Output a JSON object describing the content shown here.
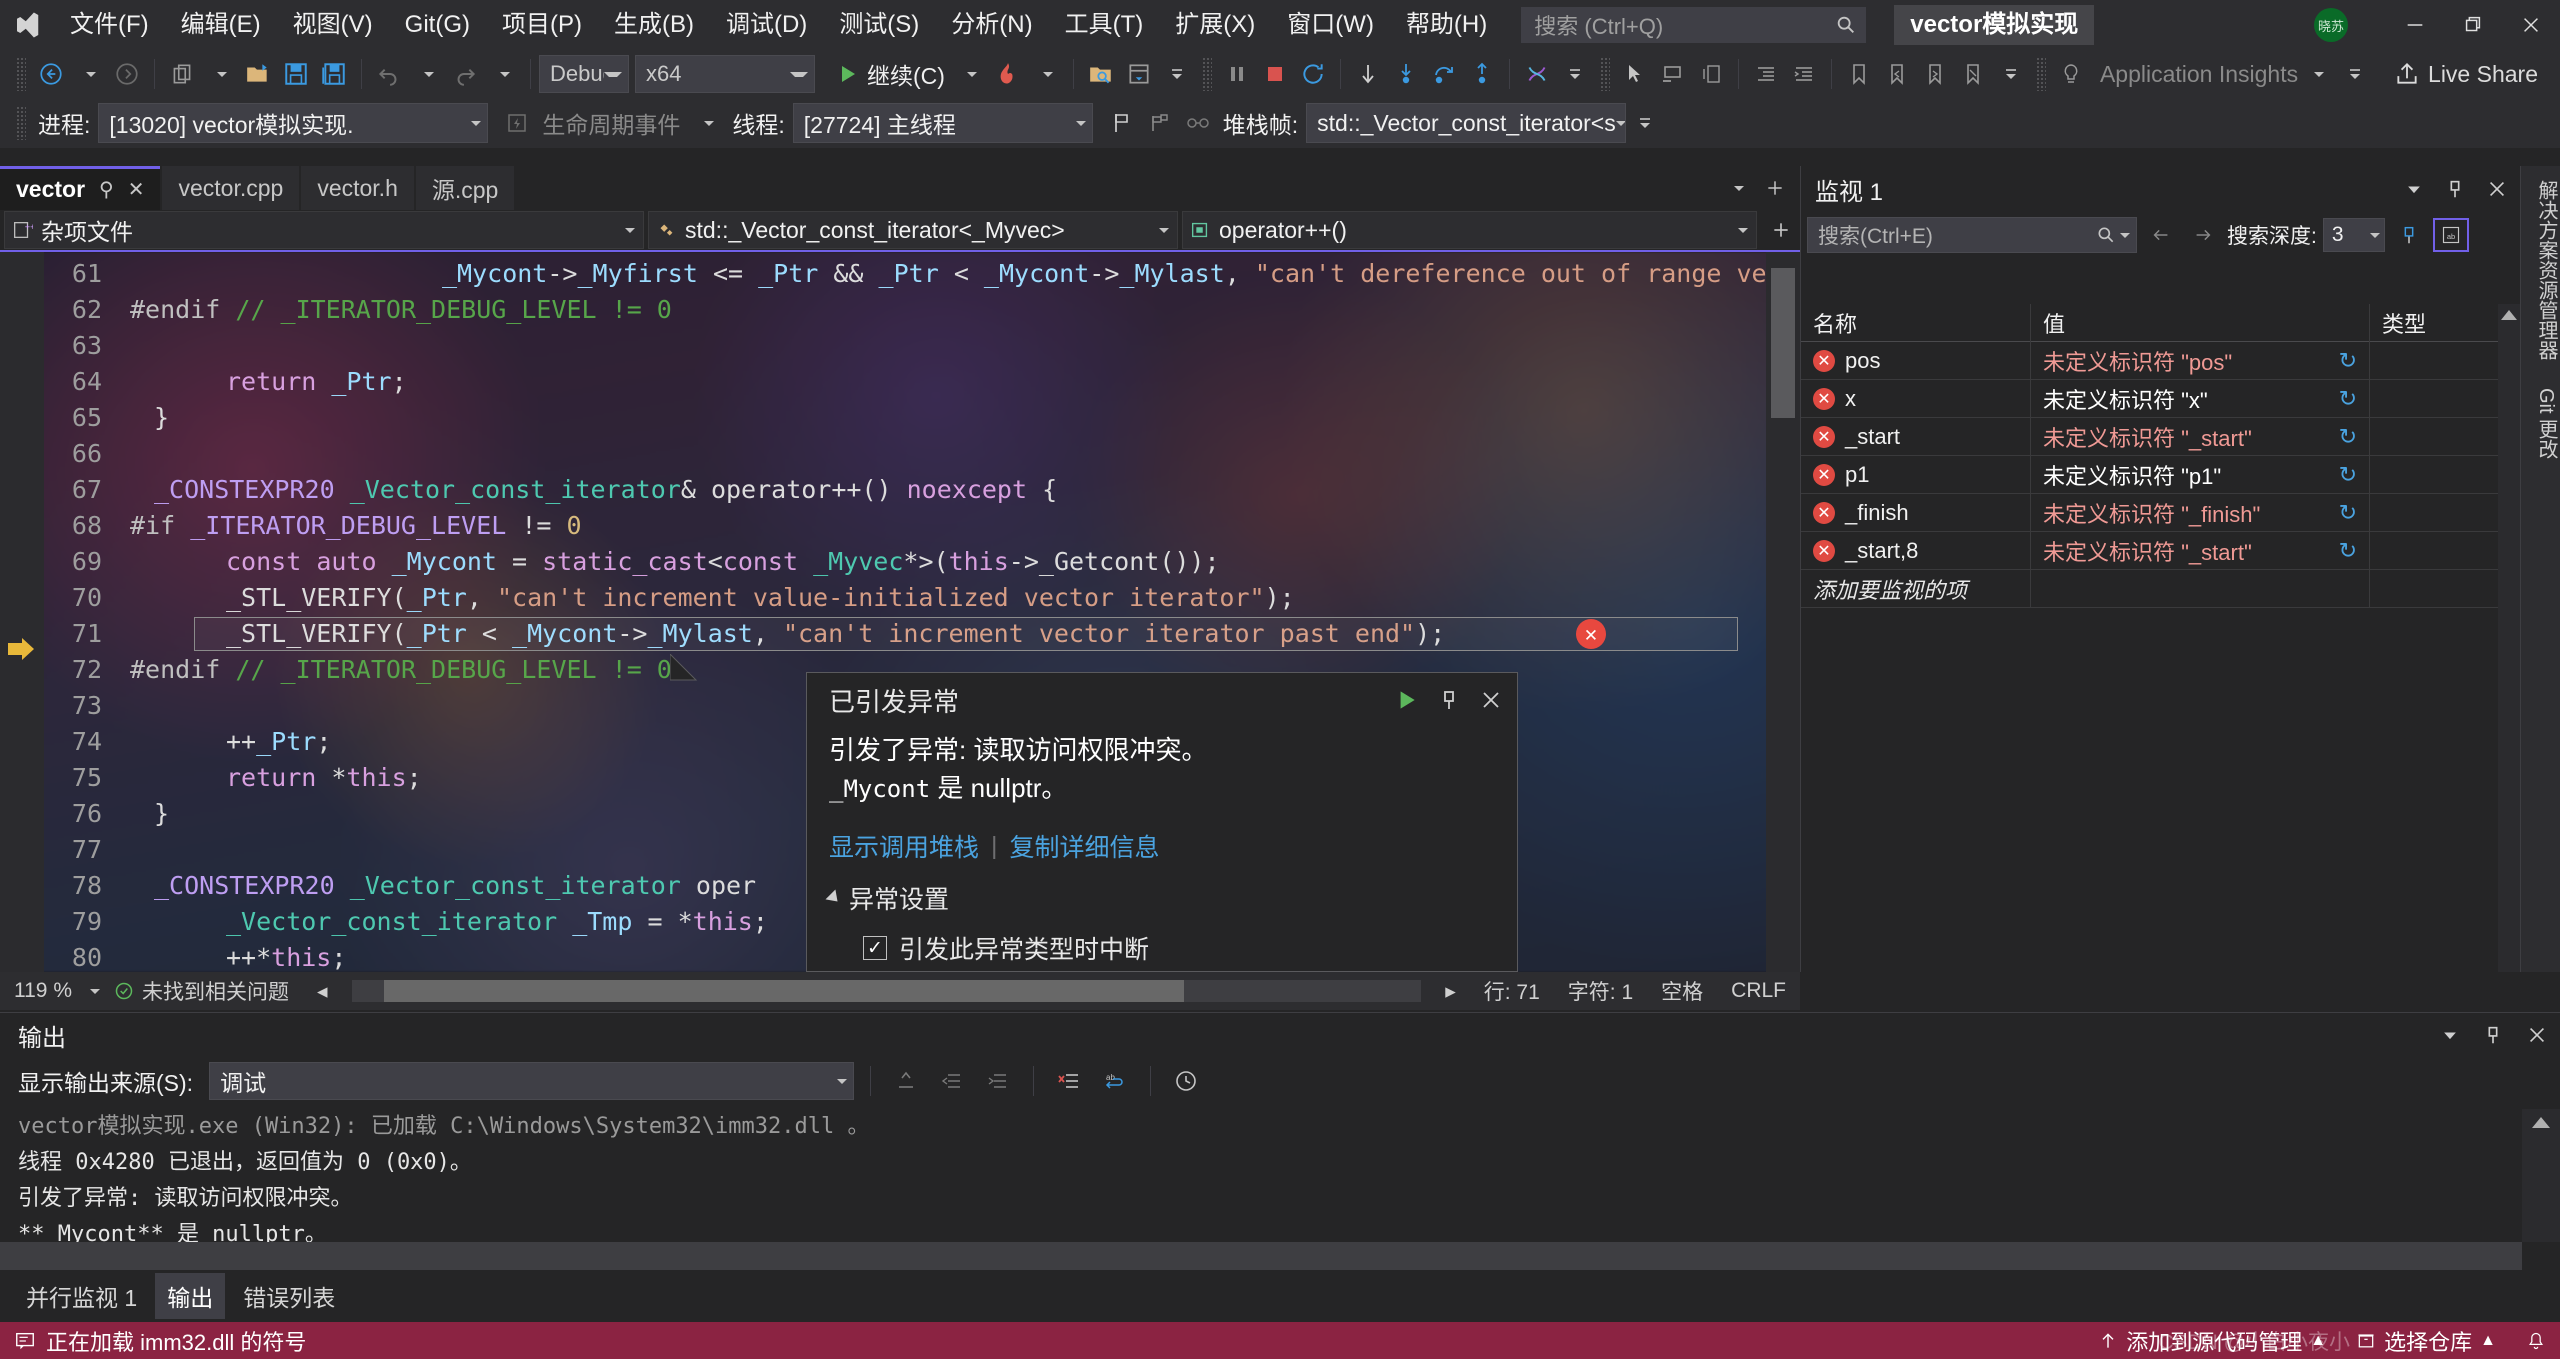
{
  "titlebar": {
    "logo": "visual-studio-logo",
    "menus": [
      "文件(F)",
      "编辑(E)",
      "视图(V)",
      "Git(G)",
      "项目(P)",
      "生成(B)",
      "调试(D)",
      "测试(S)",
      "分析(N)",
      "工具(T)",
      "扩展(X)",
      "窗口(W)",
      "帮助(H)"
    ],
    "search_placeholder": "搜索 (Ctrl+Q)",
    "project_name": "vector模拟实现",
    "avatar_initials": "晓苏",
    "minimize": "—",
    "restore": "❐",
    "close": "✕"
  },
  "toolbar": {
    "config": "Debug",
    "platform": "x64",
    "continue_label": "继续(C)",
    "app_insights": "Application Insights",
    "live_share": "Live Share"
  },
  "debugbar": {
    "process_label": "进程:",
    "process_value": "[13020] vector模拟实现.",
    "lifecycle_label": "生命周期事件",
    "thread_label": "线程:",
    "thread_value": "[27724] 主线程",
    "stack_label": "堆栈帧:",
    "stack_value": "std::_Vector_const_iterator<s"
  },
  "editor": {
    "tabs": [
      {
        "label": "vector",
        "active": true
      },
      {
        "label": "vector.cpp",
        "active": false
      },
      {
        "label": "vector.h",
        "active": false
      },
      {
        "label": "源.cpp",
        "active": false
      }
    ],
    "nav_scope": "杂项文件",
    "nav_type": "std::_Vector_const_iterator<_Myvec>",
    "nav_member": "operator++()",
    "lines": [
      {
        "num": "61",
        "indent": 13,
        "segs": [
          {
            "t": "_Mycont",
            "c": "k-var"
          },
          {
            "t": "->",
            "c": "k-id"
          },
          {
            "t": "_Myfirst",
            "c": "k-var"
          },
          {
            "t": " <= ",
            "c": "k-id"
          },
          {
            "t": "_Ptr",
            "c": "k-var"
          },
          {
            "t": " && ",
            "c": "k-id"
          },
          {
            "t": "_Ptr",
            "c": "k-var"
          },
          {
            "t": " < ",
            "c": "k-id"
          },
          {
            "t": "_Mycont",
            "c": "k-var"
          },
          {
            "t": "->",
            "c": "k-id"
          },
          {
            "t": "_Mylast",
            "c": "k-var"
          },
          {
            "t": ", ",
            "c": "k-id"
          },
          {
            "t": "\"can't dereference out of range vector itera",
            "c": "k-str"
          }
        ]
      },
      {
        "num": "62",
        "indent": 0,
        "segs": [
          {
            "t": "#endif",
            "c": "k-pp"
          },
          {
            "t": " ",
            "c": "k-id"
          },
          {
            "t": "// _ITERATOR_DEBUG_LEVEL != 0",
            "c": "k-cmt"
          }
        ]
      },
      {
        "num": "63",
        "indent": 0,
        "segs": []
      },
      {
        "num": "64",
        "indent": 4,
        "segs": [
          {
            "t": "return",
            "c": "k-key"
          },
          {
            "t": " ",
            "c": "k-id"
          },
          {
            "t": "_Ptr",
            "c": "k-var"
          },
          {
            "t": ";",
            "c": "k-id"
          }
        ]
      },
      {
        "num": "65",
        "indent": 1,
        "segs": [
          {
            "t": "}",
            "c": "k-id"
          }
        ]
      },
      {
        "num": "66",
        "indent": 0,
        "segs": []
      },
      {
        "num": "67",
        "indent": 1,
        "segs": [
          {
            "t": "_CONSTEXPR20",
            "c": "k-mac"
          },
          {
            "t": " ",
            "c": "k-id"
          },
          {
            "t": "_Vector_const_iterator",
            "c": "k-type"
          },
          {
            "t": "& ",
            "c": "k-id"
          },
          {
            "t": "operator++",
            "c": "k-id"
          },
          {
            "t": "() ",
            "c": "k-id"
          },
          {
            "t": "noexcept",
            "c": "k-key"
          },
          {
            "t": " {",
            "c": "k-id"
          }
        ]
      },
      {
        "num": "68",
        "indent": 0,
        "segs": [
          {
            "t": "#if",
            "c": "k-pp"
          },
          {
            "t": " ",
            "c": "k-id"
          },
          {
            "t": "_ITERATOR_DEBUG_LEVEL",
            "c": "k-mac"
          },
          {
            "t": " != ",
            "c": "k-id"
          },
          {
            "t": "0",
            "c": "k-num"
          }
        ]
      },
      {
        "num": "69",
        "indent": 4,
        "segs": [
          {
            "t": "const",
            "c": "k-key"
          },
          {
            "t": " ",
            "c": "k-id"
          },
          {
            "t": "auto",
            "c": "k-key"
          },
          {
            "t": " ",
            "c": "k-id"
          },
          {
            "t": "_Mycont",
            "c": "k-var"
          },
          {
            "t": " = ",
            "c": "k-id"
          },
          {
            "t": "static_cast",
            "c": "k-key"
          },
          {
            "t": "<",
            "c": "k-id"
          },
          {
            "t": "const",
            "c": "k-key"
          },
          {
            "t": " ",
            "c": "k-id"
          },
          {
            "t": "_Myvec",
            "c": "k-type"
          },
          {
            "t": "*>(",
            "c": "k-id"
          },
          {
            "t": "this",
            "c": "k-key"
          },
          {
            "t": "->",
            "c": "k-id"
          },
          {
            "t": "_Getcont",
            "c": "k-id"
          },
          {
            "t": "());",
            "c": "k-id"
          }
        ]
      },
      {
        "num": "70",
        "indent": 4,
        "segs": [
          {
            "t": "_STL_VERIFY",
            "c": "k-id"
          },
          {
            "t": "(",
            "c": "k-id"
          },
          {
            "t": "_Ptr",
            "c": "k-var"
          },
          {
            "t": ", ",
            "c": "k-id"
          },
          {
            "t": "\"can't increment value-initialized vector iterator\"",
            "c": "k-str"
          },
          {
            "t": ");",
            "c": "k-id"
          }
        ]
      },
      {
        "num": "71",
        "indent": 4,
        "current": true,
        "segs": [
          {
            "t": "_STL_VERIFY",
            "c": "k-id"
          },
          {
            "t": "(",
            "c": "k-id"
          },
          {
            "t": "_Ptr",
            "c": "k-var"
          },
          {
            "t": " < ",
            "c": "k-id"
          },
          {
            "t": "_Mycont",
            "c": "k-var"
          },
          {
            "t": "->",
            "c": "k-id"
          },
          {
            "t": "_Mylast",
            "c": "k-var"
          },
          {
            "t": ", ",
            "c": "k-id"
          },
          {
            "t": "\"can't increment vector iterator past end\"",
            "c": "k-str"
          },
          {
            "t": ");",
            "c": "k-id"
          }
        ]
      },
      {
        "num": "72",
        "indent": 0,
        "segs": [
          {
            "t": "#endif",
            "c": "k-pp"
          },
          {
            "t": " ",
            "c": "k-id"
          },
          {
            "t": "// _ITERATOR_DEBUG_LEVEL != 0",
            "c": "k-cmt"
          }
        ]
      },
      {
        "num": "73",
        "indent": 0,
        "segs": []
      },
      {
        "num": "74",
        "indent": 4,
        "segs": [
          {
            "t": "++",
            "c": "k-id"
          },
          {
            "t": "_Ptr",
            "c": "k-var"
          },
          {
            "t": ";",
            "c": "k-id"
          }
        ]
      },
      {
        "num": "75",
        "indent": 4,
        "segs": [
          {
            "t": "return",
            "c": "k-key"
          },
          {
            "t": " *",
            "c": "k-id"
          },
          {
            "t": "this",
            "c": "k-key"
          },
          {
            "t": ";",
            "c": "k-id"
          }
        ]
      },
      {
        "num": "76",
        "indent": 1,
        "segs": [
          {
            "t": "}",
            "c": "k-id"
          }
        ]
      },
      {
        "num": "77",
        "indent": 0,
        "segs": []
      },
      {
        "num": "78",
        "indent": 1,
        "segs": [
          {
            "t": "_CONSTEXPR20",
            "c": "k-mac"
          },
          {
            "t": " ",
            "c": "k-id"
          },
          {
            "t": "_Vector_const_iterator",
            "c": "k-type"
          },
          {
            "t": " ",
            "c": "k-id"
          },
          {
            "t": "oper",
            "c": "k-id"
          }
        ]
      },
      {
        "num": "79",
        "indent": 4,
        "segs": [
          {
            "t": "_Vector_const_iterator",
            "c": "k-type"
          },
          {
            "t": " ",
            "c": "k-id"
          },
          {
            "t": "_Tmp",
            "c": "k-var"
          },
          {
            "t": " = *",
            "c": "k-id"
          },
          {
            "t": "this",
            "c": "k-key"
          },
          {
            "t": ";",
            "c": "k-id"
          }
        ]
      },
      {
        "num": "80",
        "indent": 4,
        "segs": [
          {
            "t": "++*",
            "c": "k-id"
          },
          {
            "t": "this",
            "c": "k-key"
          },
          {
            "t": ";",
            "c": "k-id"
          }
        ]
      }
    ],
    "status": {
      "zoom": "119 %",
      "issues": "未找到相关问题",
      "line": "行: 71",
      "col": "字符: 1",
      "spaces": "空格",
      "eol": "CRLF"
    }
  },
  "exception_popup": {
    "title": "已引发异常",
    "message_line1": "引发了异常: 读取访问权限冲突。",
    "message_var": "_Mycont",
    "message_line2_rest": " 是 nullptr。",
    "link_stack": "显示调用堆栈",
    "link_copy": "复制详细信息",
    "settings_label": "异常设置",
    "checkbox_label": "引发此异常类型时中断",
    "checkbox_checked": "✓"
  },
  "watch": {
    "title": "监视 1",
    "search_placeholder": "搜索(Ctrl+E)",
    "depth_label": "搜索深度:",
    "depth_value": "3",
    "columns": [
      "名称",
      "值",
      "类型"
    ],
    "rows": [
      {
        "name": "pos",
        "value": "未定义标识符 \"pos\"",
        "err": true,
        "type": ""
      },
      {
        "name": "x",
        "value": "未定义标识符 \"x\"",
        "err": false,
        "type": ""
      },
      {
        "name": "_start",
        "value": "未定义标识符 \"_start\"",
        "err": true,
        "type": ""
      },
      {
        "name": "p1",
        "value": "未定义标识符 \"p1\"",
        "err": false,
        "type": ""
      },
      {
        "name": "_finish",
        "value": "未定义标识符 \"_finish\"",
        "err": true,
        "type": ""
      },
      {
        "name": "_start,8",
        "value": "未定义标识符 \"_start\"",
        "err": true,
        "type": ""
      }
    ],
    "add_row": "添加要监视的项",
    "refresh_glyph": "↻"
  },
  "vertical_tabs": [
    "解决方案资源管理器",
    "Git 更改"
  ],
  "output": {
    "title": "输出",
    "source_label": "显示输出来源(S):",
    "source_value": "调试",
    "lines": [
      {
        "text": "vector模拟实现.exe (Win32): 已加载 C:\\Windows\\System32\\imm32.dll 。",
        "faded": true
      },
      {
        "text": "线程 0x4280 已退出，返回值为 0 (0x0)。",
        "faded": false
      },
      {
        "text": "引发了异常: 读取访问权限冲突。",
        "faded": false
      },
      {
        "text": "**_Mycont** 是 nullptr。",
        "faded": false
      }
    ]
  },
  "bottom_tabs": [
    {
      "label": "并行监视 1",
      "active": false
    },
    {
      "label": "输出",
      "active": true
    },
    {
      "label": "错误列表",
      "active": false
    }
  ],
  "statusbar": {
    "color": "#8b2342",
    "message": "正在加载 imm32.dll 的符号",
    "source_control": "添加到源代码管理",
    "repo": "选择仓库",
    "watermark": "CSDN @小白小夜小"
  }
}
